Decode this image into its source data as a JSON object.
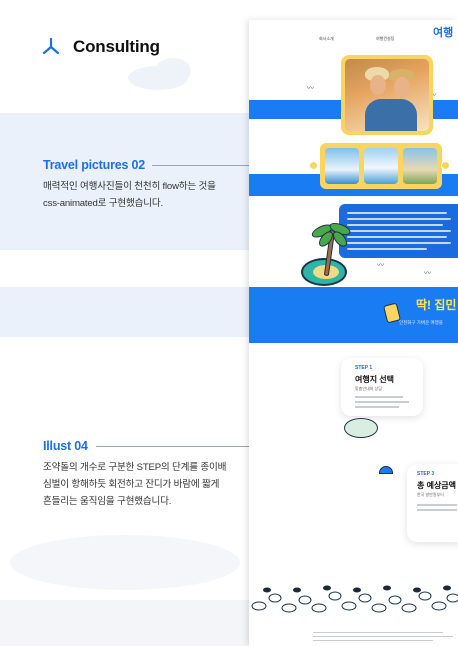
{
  "brand": {
    "title": "Consulting",
    "icon": "tri-node-icon",
    "accent": "#1c6fe8"
  },
  "sections": [
    {
      "title": "Travel pictures 02",
      "description_lines": [
        "매력적인 여행사진들이 천천히 flow하는 것을",
        "css-animated로 구현했습니다."
      ]
    },
    {
      "title": "Illust 04",
      "description_lines": [
        "조약돌의 개수로 구분한 STEP의 단계를 종이배",
        "심벌이 항해하듯 회전하고 잔디가 바람에 짧게",
        "흔들리는 움직임을 구현했습니다."
      ]
    }
  ],
  "mockup": {
    "nav": [
      "회사소개",
      "여행컨설팅"
    ],
    "logo_text": "여행",
    "banner": {
      "title": "딱! 집민",
      "subtitle": "인천화구 가벼운 여행을"
    },
    "steps": [
      {
        "label": "STEP 1",
        "title": "여행지 선택",
        "sub": "맞춤안내와 상담"
      },
      {
        "label": "STEP 3",
        "title": "총 예상금액",
        "sub": "한국 발만원부터"
      }
    ]
  },
  "colors": {
    "blue": "#1a7cf2",
    "yellow": "#f8d560",
    "dark": "#18324c",
    "band": "#eaf1fb"
  }
}
